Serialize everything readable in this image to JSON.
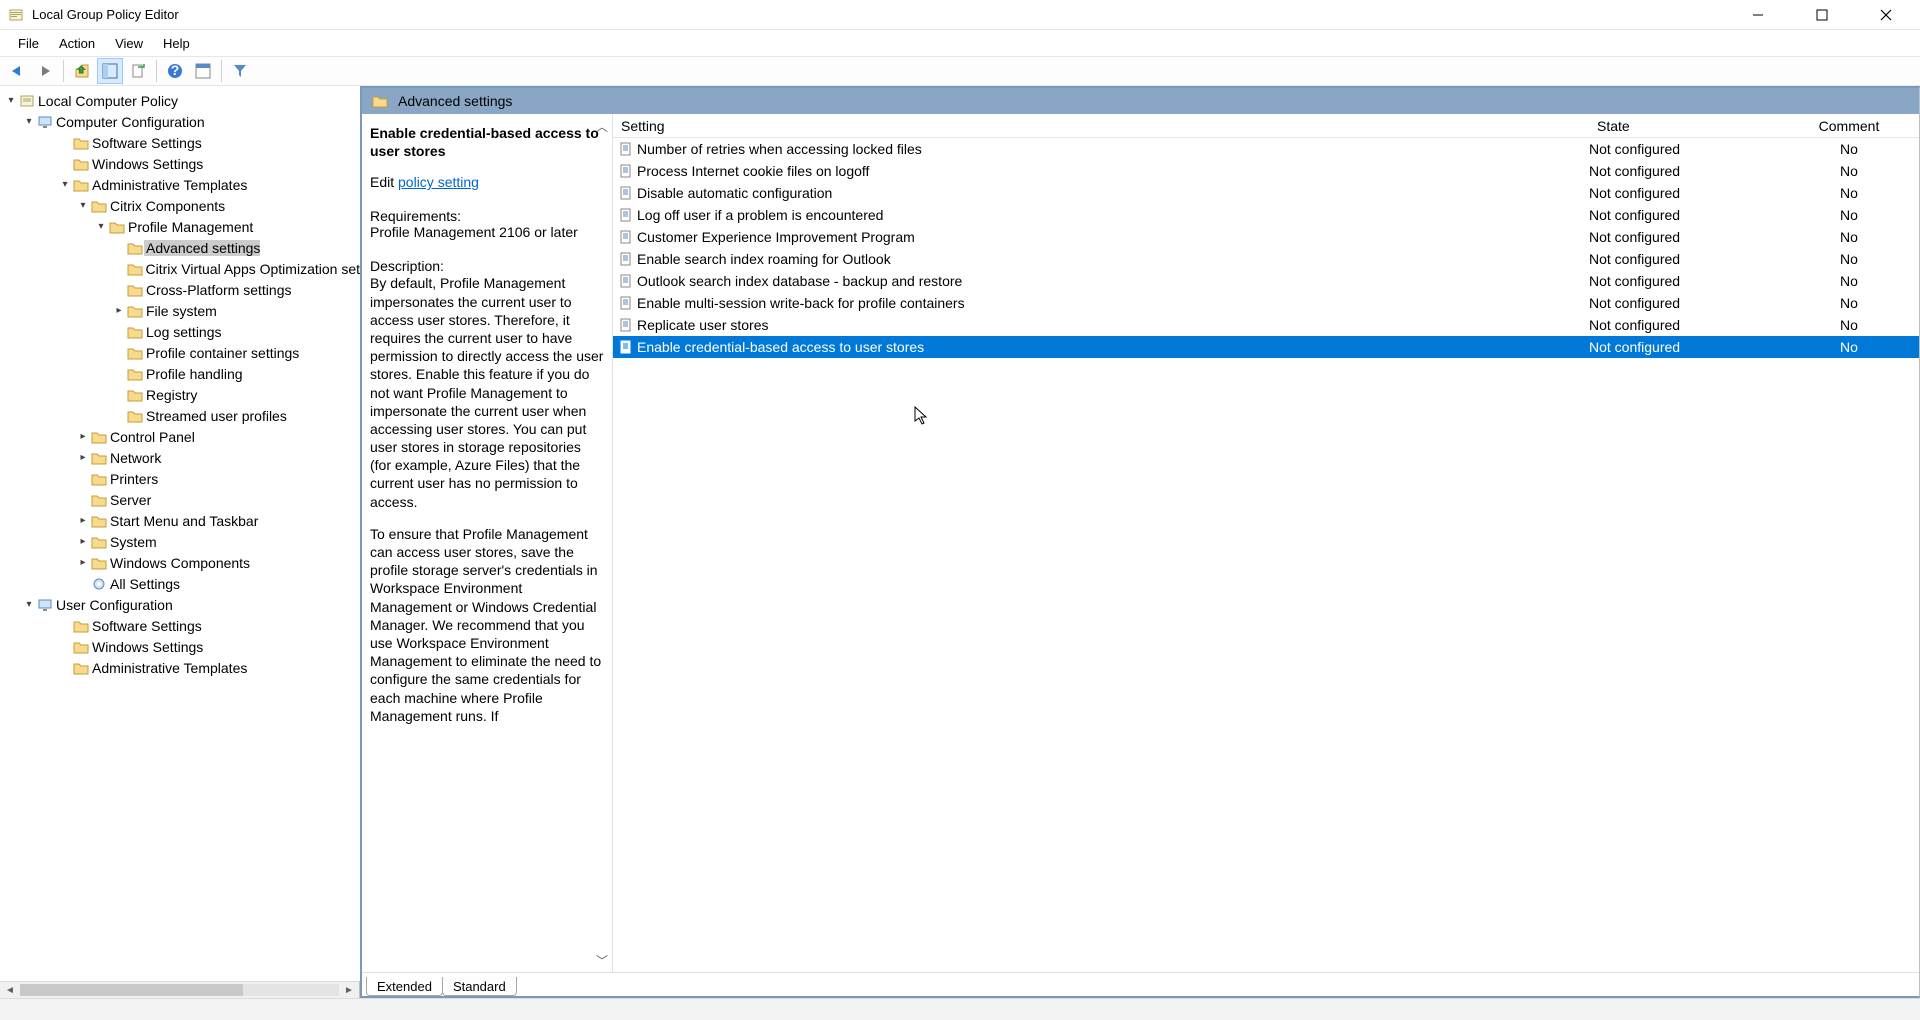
{
  "window": {
    "title": "Local Group Policy Editor"
  },
  "menu": {
    "items": [
      "File",
      "Action",
      "View",
      "Help"
    ]
  },
  "tree": {
    "root": "Local Computer Policy",
    "computer_config": "Computer Configuration",
    "user_config": "User Configuration",
    "cc_children": [
      {
        "label": "Software Settings",
        "indent": 3,
        "chevron": ""
      },
      {
        "label": "Windows Settings",
        "indent": 3,
        "chevron": ""
      },
      {
        "label": "Administrative Templates",
        "indent": 3,
        "chevron": "down"
      }
    ],
    "admin_templates_children": [
      {
        "label": "Citrix Components",
        "indent": 4,
        "chevron": "down"
      }
    ],
    "citrix_children": [
      {
        "label": "Profile Management",
        "indent": 5,
        "chevron": "down"
      }
    ],
    "pm_children": [
      {
        "label": "Advanced settings",
        "indent": 6,
        "chevron": "",
        "selected": true
      },
      {
        "label": "Citrix Virtual Apps Optimization set",
        "indent": 6,
        "chevron": ""
      },
      {
        "label": "Cross-Platform settings",
        "indent": 6,
        "chevron": ""
      },
      {
        "label": "File system",
        "indent": 6,
        "chevron": "right"
      },
      {
        "label": "Log settings",
        "indent": 6,
        "chevron": ""
      },
      {
        "label": "Profile container settings",
        "indent": 6,
        "chevron": ""
      },
      {
        "label": "Profile handling",
        "indent": 6,
        "chevron": ""
      },
      {
        "label": "Registry",
        "indent": 6,
        "chevron": ""
      },
      {
        "label": "Streamed user profiles",
        "indent": 6,
        "chevron": ""
      }
    ],
    "admin_rest": [
      {
        "label": "Control Panel",
        "indent": 4,
        "chevron": "right"
      },
      {
        "label": "Network",
        "indent": 4,
        "chevron": "right"
      },
      {
        "label": "Printers",
        "indent": 4,
        "chevron": ""
      },
      {
        "label": "Server",
        "indent": 4,
        "chevron": ""
      },
      {
        "label": "Start Menu and Taskbar",
        "indent": 4,
        "chevron": "right"
      },
      {
        "label": "System",
        "indent": 4,
        "chevron": "right"
      },
      {
        "label": "Windows Components",
        "indent": 4,
        "chevron": "right"
      },
      {
        "label": "All Settings",
        "indent": 4,
        "chevron": "",
        "icon": "gear"
      }
    ],
    "uc_children": [
      {
        "label": "Software Settings",
        "indent": 3,
        "chevron": ""
      },
      {
        "label": "Windows Settings",
        "indent": 3,
        "chevron": ""
      },
      {
        "label": "Administrative Templates",
        "indent": 3,
        "chevron": ""
      }
    ]
  },
  "header": {
    "title": "Advanced settings"
  },
  "description": {
    "title": "Enable credential-based access to user stores",
    "edit_prefix": "Edit ",
    "edit_link": "policy setting",
    "req_label": "Requirements:",
    "req_value": "Profile Management 2106 or later",
    "desc_label": "Description:",
    "desc_body": "By default, Profile Management impersonates the current user to access user stores. Therefore, it requires the current user to have permission to directly access the user stores. Enable this feature if you do not want Profile Management to impersonate the current user when accessing user stores. You can put user stores in storage repositories (for example, Azure Files) that the current user has no permission to access.\n\nTo ensure that Profile Management can access user stores, save the profile storage server's credentials in Workspace Environment Management or Windows Credential Manager. We recommend that you use Workspace Environment Management to eliminate the need to configure the same credentials for each machine where Profile Management runs. If"
  },
  "settings": {
    "columns": {
      "setting": "Setting",
      "state": "State",
      "comment": "Comment"
    },
    "rows": [
      {
        "label": "Number of retries when accessing locked files",
        "state": "Not configured",
        "comment": "No"
      },
      {
        "label": "Process Internet cookie files on logoff",
        "state": "Not configured",
        "comment": "No"
      },
      {
        "label": "Disable automatic configuration",
        "state": "Not configured",
        "comment": "No"
      },
      {
        "label": "Log off user if a problem is encountered",
        "state": "Not configured",
        "comment": "No"
      },
      {
        "label": "Customer Experience Improvement Program",
        "state": "Not configured",
        "comment": "No"
      },
      {
        "label": "Enable search index roaming for Outlook",
        "state": "Not configured",
        "comment": "No"
      },
      {
        "label": "Outlook search index database - backup and restore",
        "state": "Not configured",
        "comment": "No"
      },
      {
        "label": "Enable multi-session write-back for profile containers",
        "state": "Not configured",
        "comment": "No"
      },
      {
        "label": "Replicate user stores",
        "state": "Not configured",
        "comment": "No"
      },
      {
        "label": "Enable credential-based access to user stores",
        "state": "Not configured",
        "comment": "No",
        "selected": true
      }
    ]
  },
  "tabs": {
    "extended": "Extended",
    "standard": "Standard"
  }
}
